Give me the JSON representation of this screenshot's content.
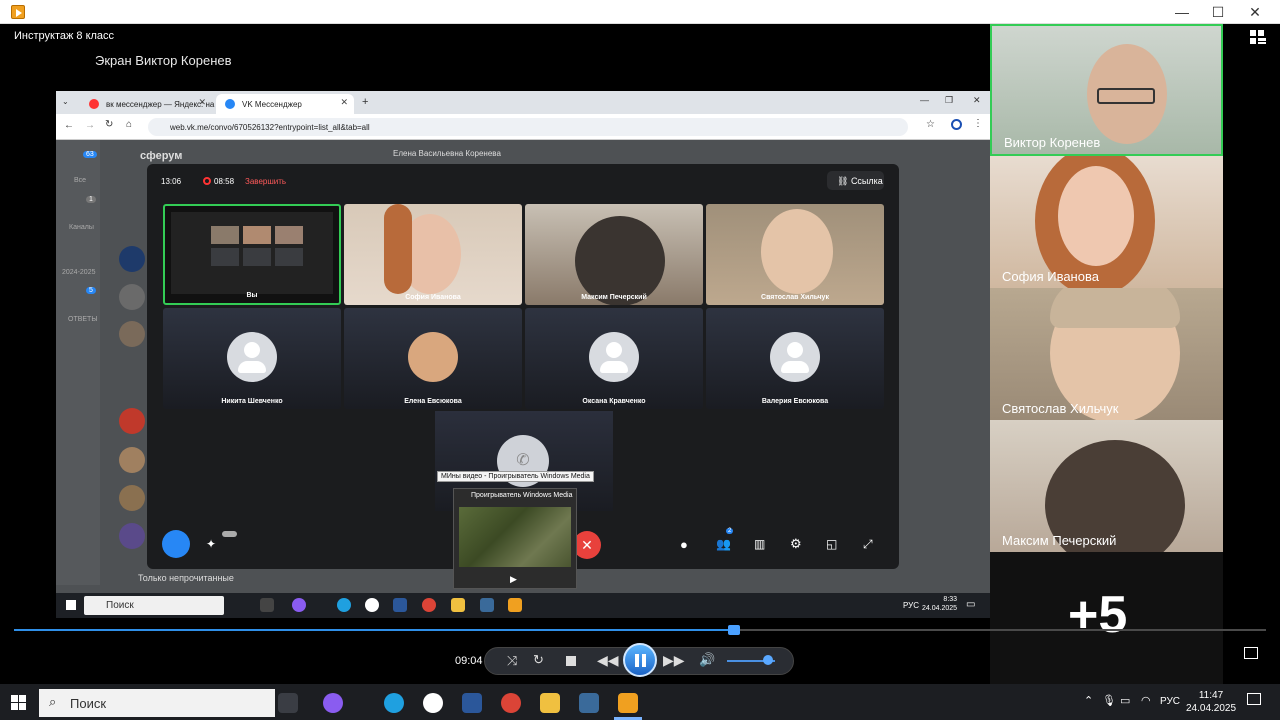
{
  "window": {
    "controls": [
      "—",
      "☐",
      "✕"
    ]
  },
  "conference": {
    "title": "Инструктаж 8 класс",
    "screen_owner": "Экран Виктор Коренев"
  },
  "browser": {
    "tabs": [
      {
        "label": "вк мессенджер — Яндекс: на"
      },
      {
        "label": "VK Мессенджер"
      }
    ],
    "url": "web.vk.me/convo/670526132?entrypoint=list_all&tab=all"
  },
  "vk": {
    "app_name": "сферум",
    "chat_header": "Елена Васильевна Коренева",
    "unread_filter": "Только непрочитанные",
    "left_labels": [
      "Все",
      "Каналы",
      "2024-2025",
      "ОТВЕТЫ"
    ],
    "badges": [
      "63",
      "1",
      "5"
    ]
  },
  "call": {
    "elapsed": "13:06",
    "recording_time": "08:58",
    "end_label": "Завершить",
    "link_label": "Ссылка",
    "participants": [
      {
        "name": "Вы"
      },
      {
        "name": "София Иванова"
      },
      {
        "name": "Максим Печерский"
      },
      {
        "name": "Святослав Хильчук"
      },
      {
        "name": "Никита Шевченко"
      },
      {
        "name": "Елена Евсюкова"
      },
      {
        "name": "Оксана Кравченко"
      },
      {
        "name": "Валерия Евсюкова"
      }
    ],
    "badge_count": "2"
  },
  "taskbar_preview": {
    "tooltip": "МИны видео - Проигрыватель Windows Media",
    "title": "Проигрыватель Windows Media"
  },
  "inner_taskbar": {
    "search": "Поиск",
    "lang": "РУС",
    "time": "8:33",
    "date": "24.04.2025"
  },
  "side_participants": [
    {
      "name": "Виктор Коренев"
    },
    {
      "name": "София Иванова"
    },
    {
      "name": "Святослав Хильчук"
    },
    {
      "name": "Максим Печерский"
    }
  ],
  "more_count": "+5",
  "player": {
    "position": "09:04",
    "progress": 0.575,
    "volume": 0.75
  },
  "taskbar": {
    "search": "Поиск",
    "lang": "РУС",
    "time": "11:47",
    "date": "24.04.2025"
  },
  "colors": {
    "accent": "#2f8fe8",
    "record": "#ff3333",
    "active_tile": "#33cc55",
    "hangup": "#e8413c"
  }
}
